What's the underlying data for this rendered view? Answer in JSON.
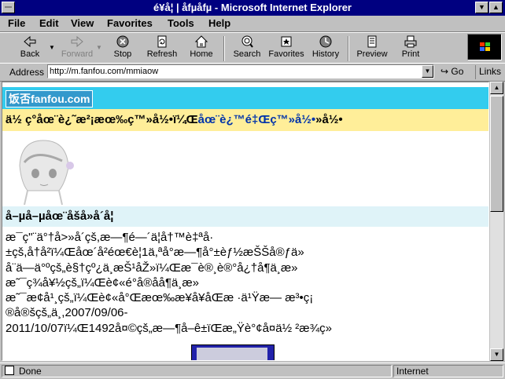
{
  "window": {
    "title": "é¥­å¦ | åfµåfµ - Microsoft Internet Explorer",
    "min_label": "▼",
    "max_label": "▲"
  },
  "menu": {
    "items": [
      "File",
      "Edit",
      "View",
      "Favorites",
      "Tools",
      "Help"
    ]
  },
  "toolbar": {
    "back": "Back",
    "forward": "Forward",
    "stop": "Stop",
    "refresh": "Refresh",
    "home": "Home",
    "search": "Search",
    "favorites": "Favorites",
    "history": "History",
    "preview": "Preview",
    "print": "Print"
  },
  "address": {
    "label": "Address",
    "url": "http://m.fanfou.com/mmiaow",
    "go": "Go",
    "links": "Links"
  },
  "page": {
    "logo": "饭否fanfou.com",
    "header_line_a": "ä½ ç°åœ¨è¿˜æ²¡æœ‰ç™»å½•ï¼Œ",
    "header_line_b": "åœ¨è¿™é‡Œç™»å½•",
    "name_line": "å–µå–µåœ¨å­šå»å´å¦",
    "body_text": "æ¯ç\"¨ä°†å>»å´çš,æ—¶é—´ä¦å†™è‡ªå·\n±çš,å†å²ï¼Œåœ´å²éœ€è¦1ä,ªå°æ—¶å°±èƒ½æŠŠå®ƒä»\nå¨ä—ä°ºçš„è§†çº¿ä¸­æŠ¹åŽ»ï¼Œæ¯è®¸è®°å¿†å¶ä¸æ»\næ˜¯ç¾å¥½çš„ï¼Œè¢«é°å®åå¶ä¸æ»\næ˜¯æ¢å¹¸çš„ï¼Œè¢«å°Œæœ‰æ¥å¥åŒæ ·ä¹Ÿæ— æ³•ç¡\n®å®šçš„ä¸,2007/09/06-\n2011/10/07ï¼Œ1492å¤©çš„æ—¶å–ê±ïŒæ„Ÿè°¢å¤ä½ ²æ¾ç»"
  },
  "status": {
    "text": "Done",
    "zone": "Internet"
  }
}
